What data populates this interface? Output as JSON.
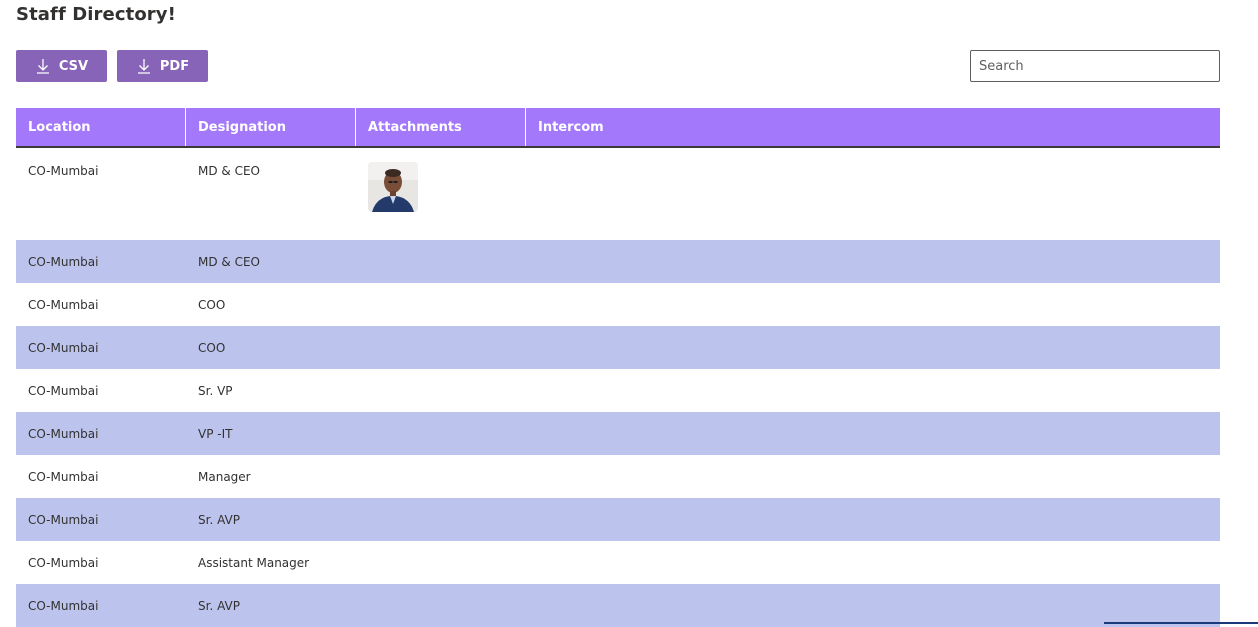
{
  "page": {
    "title": "Staff Directory!"
  },
  "toolbar": {
    "csv_label": "CSV",
    "pdf_label": "PDF",
    "download_icon": "download-icon",
    "button_color": "#8764b8"
  },
  "search": {
    "placeholder": "Search",
    "value": ""
  },
  "table": {
    "header_color": "#a378fa",
    "alt_row_color": "#bcc4ee",
    "columns": [
      "Location",
      "Designation",
      "Attachments",
      "Intercom"
    ],
    "rows": [
      {
        "location": "CO-Mumbai",
        "designation": "MD & CEO",
        "attachment": "profile-photo",
        "intercom": ""
      },
      {
        "location": "CO-Mumbai",
        "designation": "MD & CEO",
        "attachment": "",
        "intercom": ""
      },
      {
        "location": "CO-Mumbai",
        "designation": "COO",
        "attachment": "",
        "intercom": ""
      },
      {
        "location": "CO-Mumbai",
        "designation": "COO",
        "attachment": "",
        "intercom": ""
      },
      {
        "location": "CO-Mumbai",
        "designation": "Sr. VP",
        "attachment": "",
        "intercom": ""
      },
      {
        "location": "CO-Mumbai",
        "designation": "VP -IT",
        "attachment": "",
        "intercom": ""
      },
      {
        "location": "CO-Mumbai",
        "designation": "Manager",
        "attachment": "",
        "intercom": ""
      },
      {
        "location": "CO-Mumbai",
        "designation": "Sr. AVP",
        "attachment": "",
        "intercom": ""
      },
      {
        "location": "CO-Mumbai",
        "designation": "Assistant Manager",
        "attachment": "",
        "intercom": ""
      },
      {
        "location": "CO-Mumbai",
        "designation": "Sr. AVP",
        "attachment": "",
        "intercom": ""
      }
    ]
  }
}
